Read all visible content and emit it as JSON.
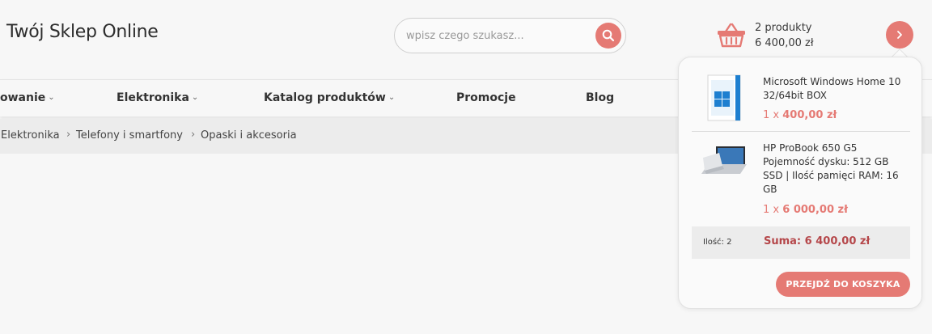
{
  "header": {
    "logo": "Twój Sklep Online",
    "search_placeholder": "wpisz czego szukasz...",
    "cart_count": "2 produkty",
    "cart_total": "6 400,00 zł"
  },
  "nav": {
    "items": [
      {
        "label": "owanie",
        "has_chevron": true
      },
      {
        "label": "Elektronika",
        "has_chevron": true
      },
      {
        "label": "Katalog produktów",
        "has_chevron": true
      },
      {
        "label": "Promocje",
        "has_chevron": false
      },
      {
        "label": "Blog",
        "has_chevron": false
      }
    ]
  },
  "breadcrumb": [
    "Elektronika",
    "Telefony i smartfony",
    "Opaski i akcesoria"
  ],
  "cart_dropdown": {
    "items": [
      {
        "name": "Microsoft Windows Home 10 32/64bit BOX",
        "qty": "1 x",
        "price": "400,00 zł",
        "thumb_icon": "windows-box-icon"
      },
      {
        "name": "HP ProBook 650 G5 Pojemność dysku: 512 GB SSD | Ilość pamięci RAM: 16 GB",
        "qty": "1 x",
        "price": "6 000,00 zł",
        "thumb_icon": "laptop-icon"
      }
    ],
    "count_label": "Ilość: 2",
    "sum_label": "Suma: 6 400,00 zł",
    "checkout_label": "PRZEJDŹ DO KOSZYKA"
  },
  "colors": {
    "accent": "#e57a74",
    "sum": "#b5474a",
    "background": "#f7f7f7"
  }
}
